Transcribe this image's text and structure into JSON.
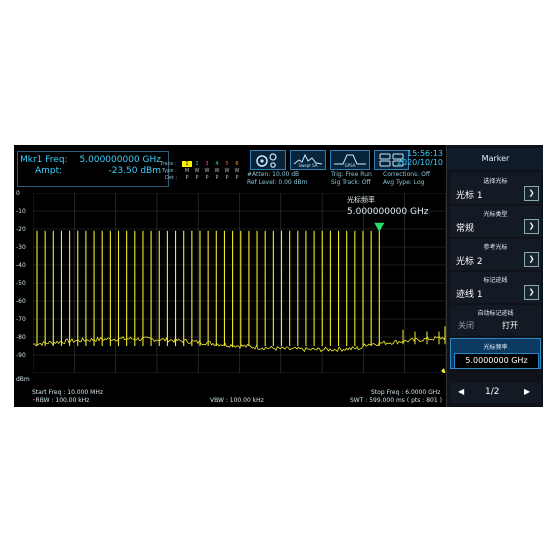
{
  "marker_readout": {
    "freq_label": "Mkr1 Freq:",
    "freq_value": "5.000000000 GHz",
    "ampt_label": "Ampt:",
    "ampt_value": "-23.50 dBm"
  },
  "trace_panel": {
    "label_trace": "Trace :",
    "label_type": "Type :",
    "label_det": "Det :",
    "numbers": [
      "1",
      "2",
      "3",
      "4",
      "5",
      "6"
    ],
    "types": [
      "M",
      "W",
      "W",
      "W",
      "W",
      "W"
    ],
    "dets": [
      "P",
      "P",
      "P",
      "P",
      "P",
      "P"
    ]
  },
  "params": {
    "atten": "#Atten: 10.00 dB",
    "ref_level": "Ref Level: 0.00 dBm",
    "trig": "Trig: Free Run",
    "sig_track": "Sig Track: Off",
    "corrections": "Corrections: Off",
    "avg_type": "Avg Type: Log"
  },
  "mode_buttons": [
    {
      "label": "",
      "icon": "gear-icon"
    },
    {
      "label": "Swept SA",
      "icon": "spectrum-icon"
    },
    {
      "label": "GPSA",
      "icon": "pulse-icon"
    },
    {
      "label": "",
      "icon": "layout-icon"
    }
  ],
  "clock": {
    "time": "15:56:13",
    "date": "2020/10/10"
  },
  "plot": {
    "y_unit": "dBm",
    "y_ticks": [
      "0",
      "-10",
      "-20",
      "-30",
      "-40",
      "-50",
      "-60",
      "-70",
      "-80",
      "-90"
    ],
    "marker_annot_title": "光标频率",
    "marker_annot_value": "5.000000000 GHz",
    "trace_color": "#f1ec2b"
  },
  "bottom": {
    "start_freq": "Start Freq : 10.000 MHz",
    "stop_freq": "Stop Freq : 6.0000 GHz",
    "rbw": "RBW : 100.00 kHz",
    "vbw": "VBW : 100.00 kHz",
    "swt": "SWT : 599.000 ms ( pts : 801 )"
  },
  "sidebar": {
    "title": "Marker",
    "select_marker_cap": "选择光标",
    "select_marker_val": "光标 1",
    "marker_type_cap": "光标类型",
    "marker_type_val": "常规",
    "ref_marker_cap": "参考光标",
    "ref_marker_val": "光标 2",
    "marker_trace_cap": "标记迹线",
    "marker_trace_val": "迹线 1",
    "auto_trace_cap": "自动标记迹线",
    "auto_off": "关闭",
    "auto_on": "打开",
    "marker_freq_cap": "光标频率",
    "marker_freq_val": "5.0000000 GHz",
    "page": "1/2"
  }
}
